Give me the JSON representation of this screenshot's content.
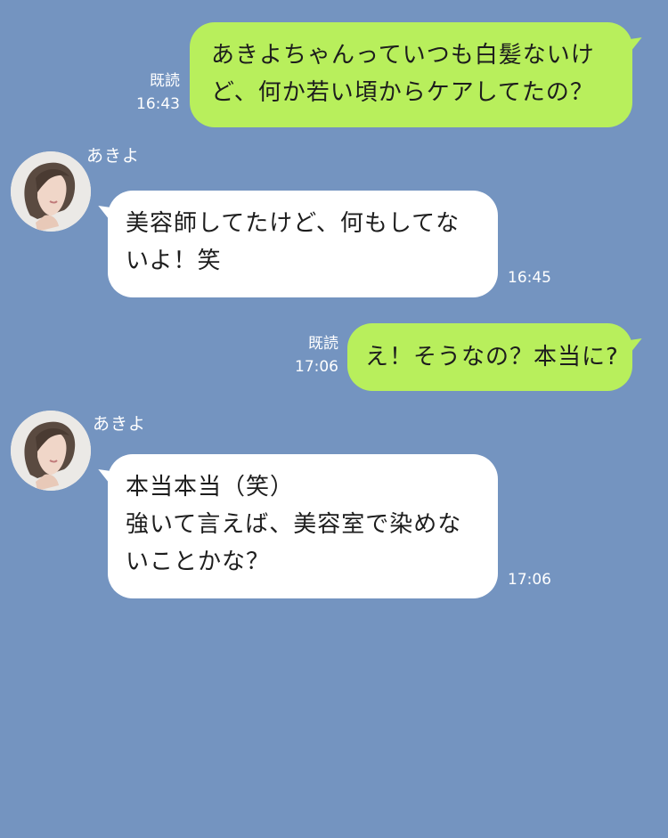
{
  "messages": [
    {
      "type": "outgoing",
      "lines": [
        "あきよちゃんっていつも白髪ないけ",
        "ど、何か若い頃からケアしてたの？"
      ],
      "read_label": "既読",
      "time": "16:43"
    },
    {
      "type": "incoming",
      "sender": "あきよ",
      "lines": [
        "美容師してたけど、何もしてな",
        "いよ！笑"
      ],
      "time": "16:45"
    },
    {
      "type": "outgoing",
      "lines": [
        "え！そうなの？本当に?"
      ],
      "read_label": "既読",
      "time": "17:06"
    },
    {
      "type": "incoming",
      "sender": "あきよ",
      "lines": [
        "本当本当（笑）",
        "強いて言えば、美容室で染めな",
        "いことかな？"
      ],
      "time": "17:06"
    }
  ],
  "colors": {
    "background": "#7494c0",
    "outgoing_bubble": "#b8ef5c",
    "incoming_bubble": "#ffffff"
  },
  "icons": {
    "avatar": "woman-portrait-avatar"
  }
}
